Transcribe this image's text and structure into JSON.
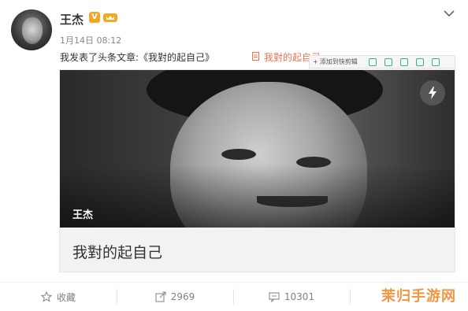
{
  "user": {
    "name": "王杰",
    "verify_badge": "V"
  },
  "post": {
    "timestamp": "1月14日 08:12",
    "text": "我发表了头条文章:《我對的起自己》",
    "link_text": "我對的起自己",
    "link_color": "#eb7350"
  },
  "clip_toolbar": {
    "add_label": "添加到快剪辑"
  },
  "card": {
    "author_overlay": "王杰",
    "title": "我對的起自己"
  },
  "actions": {
    "favorite_label": "收藏",
    "repost_count": "2969",
    "comment_count": "10301"
  },
  "watermark": "茉归手游网",
  "colors": {
    "accent": "#f5a623",
    "toolbar_icons": "#3cae85"
  }
}
